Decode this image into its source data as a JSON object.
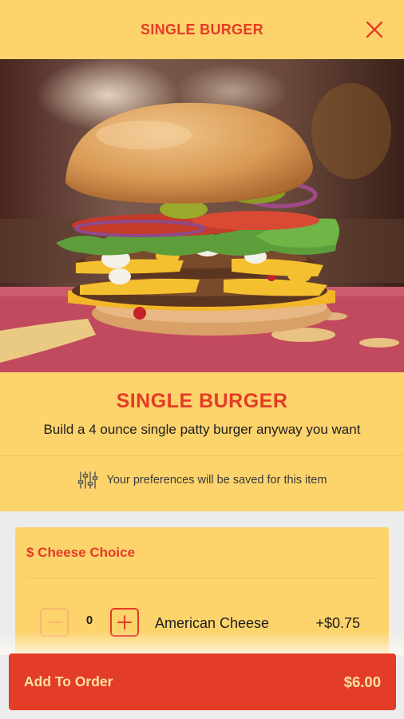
{
  "header": {
    "title": "SINGLE BURGER",
    "close_icon": "close-icon"
  },
  "item": {
    "name": "SINGLE BURGER",
    "description": "Build a 4 ounce single patty burger anyway you want",
    "image": "burger-photo"
  },
  "preferences": {
    "icon": "sliders-icon",
    "text": "Your preferences will be saved for this item"
  },
  "options_section": {
    "title": "$ Cheese Choice",
    "options": [
      {
        "name": "American Cheese",
        "quantity": "0",
        "price": "+$0.75"
      }
    ]
  },
  "footer": {
    "button_label": "Add To Order",
    "total": "$6.00"
  },
  "colors": {
    "brand_red": "#e33c27",
    "brand_yellow": "#fdd36c",
    "button_text": "#fde0a5"
  }
}
